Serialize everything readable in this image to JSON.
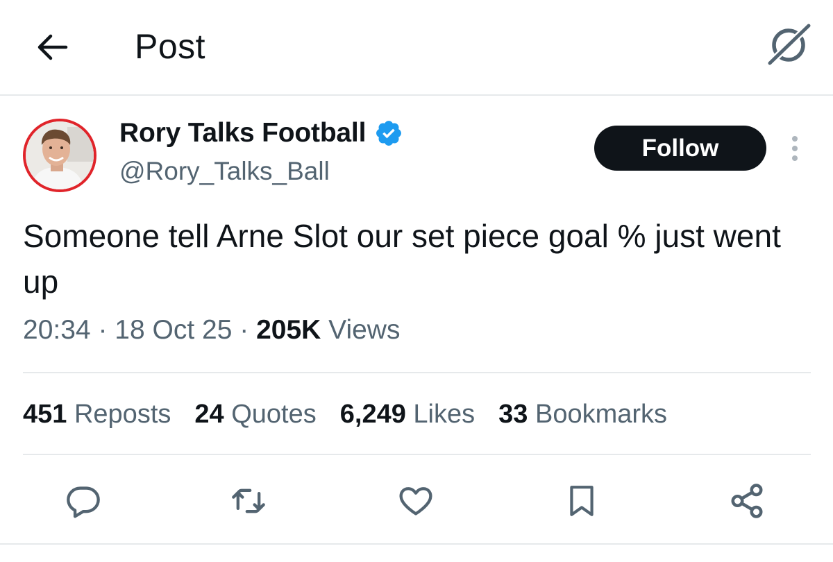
{
  "header": {
    "title": "Post",
    "back_icon": "arrow-left-icon",
    "grok_icon": "grok-icon"
  },
  "author": {
    "display_name": "Rory Talks Football",
    "handle": "@Rory_Talks_Ball",
    "verified": true,
    "verified_color": "#1d9bf0",
    "avatar_ring_color": "#e0242a"
  },
  "follow_button": {
    "label": "Follow"
  },
  "post": {
    "text": "Someone tell Arne Slot our set piece goal % just went up",
    "time": "20:34",
    "date": "18 Oct 25",
    "separator": " · ",
    "views_count": "205K",
    "views_label": "Views"
  },
  "stats": [
    {
      "count": "451",
      "label": "Reposts"
    },
    {
      "count": "24",
      "label": "Quotes"
    },
    {
      "count": "6,249",
      "label": "Likes"
    },
    {
      "count": "33",
      "label": "Bookmarks"
    }
  ],
  "actions": [
    {
      "name": "reply",
      "icon": "reply-icon"
    },
    {
      "name": "repost",
      "icon": "repost-icon"
    },
    {
      "name": "like",
      "icon": "heart-icon"
    },
    {
      "name": "bookmark",
      "icon": "bookmark-icon"
    },
    {
      "name": "share",
      "icon": "share-icon"
    }
  ],
  "colors": {
    "text_primary": "#0f1419",
    "text_secondary": "#536471",
    "divider": "#e6e9eb",
    "icon_gray": "#536471"
  }
}
